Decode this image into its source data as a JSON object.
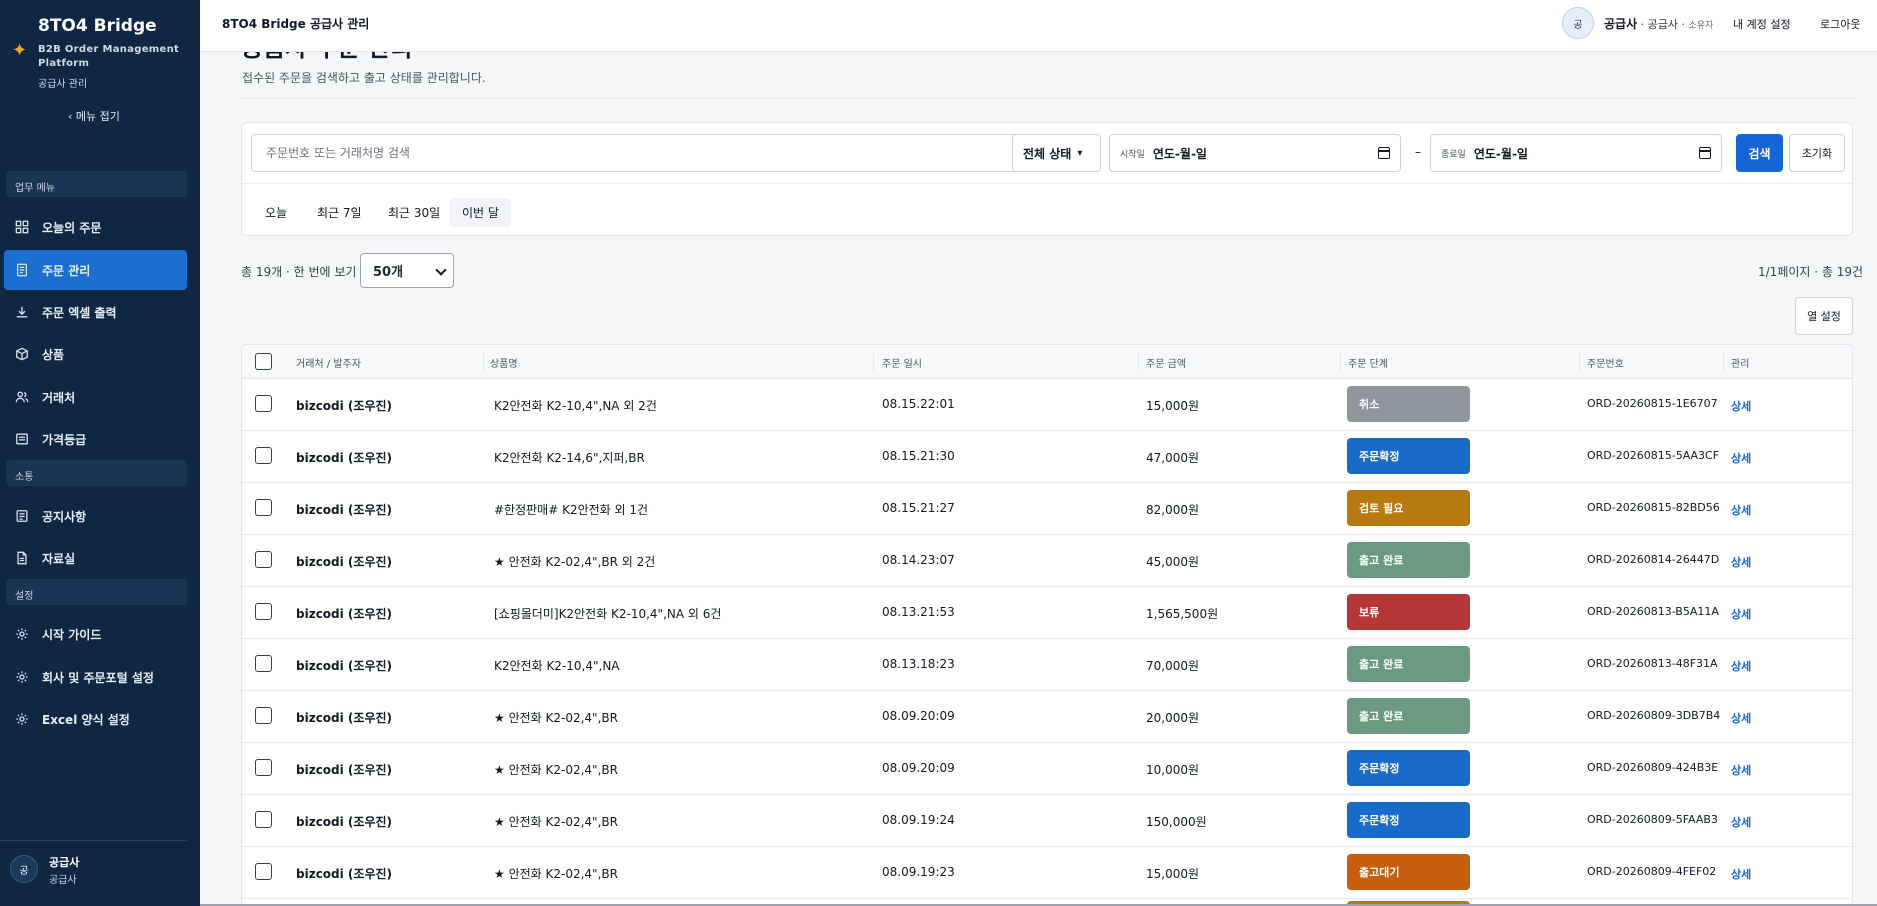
{
  "app": {
    "name": "8TO4 Bridge",
    "subtitle": "B2B Order Management Platform",
    "role_label": "공급사 관리",
    "collapse_label": "메뉴 접기"
  },
  "sidebar": {
    "sections": [
      {
        "label": "업무 메뉴"
      },
      {
        "label": "소통"
      },
      {
        "label": "설정"
      }
    ],
    "items": [
      {
        "label": "오늘의 주문",
        "icon": "grid-icon"
      },
      {
        "label": "주문 관리",
        "icon": "document-icon",
        "active": true
      },
      {
        "label": "주문 엑셀 출력",
        "icon": "download-icon"
      },
      {
        "label": "상품",
        "icon": "box-icon"
      },
      {
        "label": "거래처",
        "icon": "users-icon"
      },
      {
        "label": "가격등급",
        "icon": "list-icon"
      },
      {
        "label": "공지사항",
        "icon": "notice-icon"
      },
      {
        "label": "자료실",
        "icon": "file-icon"
      },
      {
        "label": "시작 가이드",
        "icon": "gear-icon"
      },
      {
        "label": "회사 및 주문포털 설정",
        "icon": "gear-icon"
      },
      {
        "label": "Excel 양식 설정",
        "icon": "gear-icon"
      }
    ],
    "user": {
      "avatar": "공",
      "name": "공급사",
      "role": "공급사"
    }
  },
  "topbar": {
    "title": "8TO4 Bridge 공급사 관리",
    "avatar": "공",
    "user_name": "공급사",
    "user_detail": "· 공급사 ·",
    "user_tag": "소유자",
    "account_link": "내 계정 설정",
    "logout_link": "로그아웃"
  },
  "page": {
    "heading": "공급사 주문 관리",
    "description": "접수된 주문을 검색하고 출고 상태를 관리합니다."
  },
  "filters": {
    "search_placeholder": "주문번호 또는 거래처명 검색",
    "status_value": "전체 상태",
    "start_label": "시작일",
    "start_value": "연도-월-일",
    "end_label": "종료일",
    "end_value": "연도-월-일",
    "separator": "–",
    "search_button": "검색",
    "reset_button": "초기화",
    "quick_ranges": [
      "오늘",
      "최근 7일",
      "최근 30일",
      "이번 달"
    ]
  },
  "list_meta": {
    "total": "총 19개 ·  한 번에 보기",
    "per_page": "50개",
    "page_info": "1/1페이지 · 총 19건",
    "column_settings": "열 설정"
  },
  "table": {
    "headers": [
      "거래처 / 발주자",
      "상품명",
      "주문 일시",
      "주문 금액",
      "주문 단계",
      "주문번호",
      "관리"
    ],
    "detail_label": "상세",
    "status_colors": {
      "취소": "#8f969e",
      "주문확정": "#1a6bc9",
      "검토 필요": "#b8790f",
      "출고 완료": "#6a9a80",
      "보류": "#b73636",
      "출고대기": "#c65f10"
    },
    "rows": [
      {
        "customer": "bizcodi (조우진)",
        "product": "K2안전화 K2-10,4\",NA 외 2건",
        "date": "08.15.22:01",
        "amount": "15,000원",
        "status": "취소",
        "order_no": "ORD-20260815-1E6707"
      },
      {
        "customer": "bizcodi (조우진)",
        "product": "K2안전화 K2-14,6\",지퍼,BR",
        "date": "08.15.21:30",
        "amount": "47,000원",
        "status": "주문확정",
        "order_no": "ORD-20260815-5AA3CF"
      },
      {
        "customer": "bizcodi (조우진)",
        "product": "#한정판매# K2안전화 외 1건",
        "date": "08.15.21:27",
        "amount": "82,000원",
        "status": "검토 필요",
        "order_no": "ORD-20260815-82BD56"
      },
      {
        "customer": "bizcodi (조우진)",
        "product": "★ 안전화 K2-02,4\",BR 외 2건",
        "date": "08.14.23:07",
        "amount": "45,000원",
        "status": "출고 완료",
        "order_no": "ORD-20260814-26447D"
      },
      {
        "customer": "bizcodi (조우진)",
        "product": "[쇼핑몰더미]K2안전화 K2-10,4\",NA 외 6건",
        "date": "08.13.21:53",
        "amount": "1,565,500원",
        "status": "보류",
        "order_no": "ORD-20260813-B5A11A"
      },
      {
        "customer": "bizcodi (조우진)",
        "product": "K2안전화 K2-10,4\",NA",
        "date": "08.13.18:23",
        "amount": "70,000원",
        "status": "출고 완료",
        "order_no": "ORD-20260813-48F31A"
      },
      {
        "customer": "bizcodi (조우진)",
        "product": "★ 안전화 K2-02,4\",BR",
        "date": "08.09.20:09",
        "amount": "20,000원",
        "status": "출고 완료",
        "order_no": "ORD-20260809-3DB7B4"
      },
      {
        "customer": "bizcodi (조우진)",
        "product": "★ 안전화 K2-02,4\",BR",
        "date": "08.09.20:09",
        "amount": "10,000원",
        "status": "주문확정",
        "order_no": "ORD-20260809-424B3E"
      },
      {
        "customer": "bizcodi (조우진)",
        "product": "★ 안전화 K2-02,4\",BR",
        "date": "08.09.19:24",
        "amount": "150,000원",
        "status": "주문확정",
        "order_no": "ORD-20260809-5FAAB3"
      },
      {
        "customer": "bizcodi (조우진)",
        "product": "★ 안전화 K2-02,4\",BR",
        "date": "08.09.19:23",
        "amount": "15,000원",
        "status": "출고대기",
        "order_no": "ORD-20260809-4FEF02"
      }
    ]
  }
}
